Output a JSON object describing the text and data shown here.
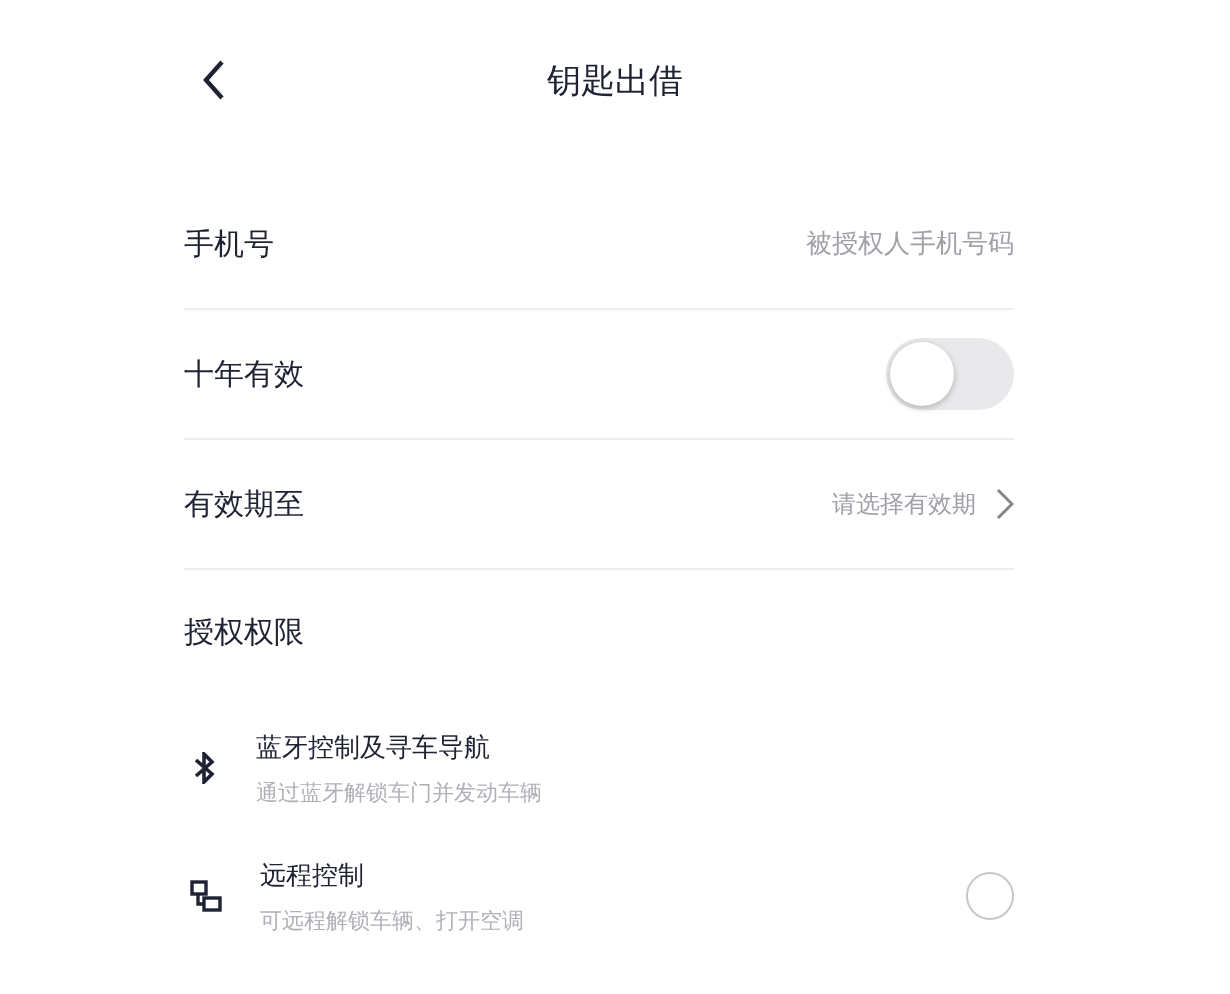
{
  "header": {
    "title": "钥匙出借"
  },
  "phone": {
    "label": "手机号",
    "placeholder": "被授权人手机号码"
  },
  "ten_year": {
    "label": "十年有效",
    "on": false
  },
  "expiry": {
    "label": "有效期至",
    "placeholder": "请选择有效期"
  },
  "permissions": {
    "title": "授权权限",
    "items": [
      {
        "kind": "bluetooth",
        "title": "蓝牙控制及寻车导航",
        "subtitle": "通过蓝牙解锁车门并发动车辆"
      },
      {
        "kind": "remote",
        "title": "远程控制",
        "subtitle": "可远程解锁车辆、打开空调",
        "checked": false
      }
    ]
  }
}
